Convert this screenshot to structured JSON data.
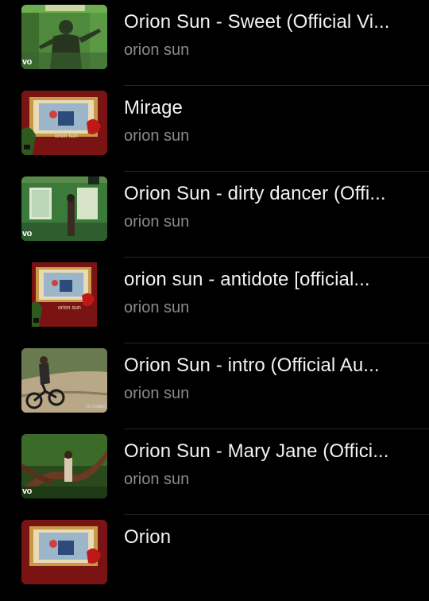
{
  "tracks": [
    {
      "title": "Orion Sun - Sweet (Official Vi...",
      "artist": "orion sun",
      "thumb": "green-room-performer",
      "badge": "vo"
    },
    {
      "title": "Mirage",
      "artist": "orion sun",
      "thumb": "album-art",
      "cover_text": "orion sun"
    },
    {
      "title": "Orion Sun - dirty dancer (Offi...",
      "artist": "orion sun",
      "thumb": "green-room-figure",
      "badge": "vo"
    },
    {
      "title": "orion sun - antidote [official...",
      "artist": "orion sun",
      "thumb": "album-art",
      "cover_text": "orion sun"
    },
    {
      "title": "Orion Sun - intro (Official Au...",
      "artist": "orion sun",
      "thumb": "bicycle-rider",
      "corner_label": "OCTOBER"
    },
    {
      "title": "Orion Sun - Mary Jane (Offici...",
      "artist": "orion sun",
      "thumb": "forest-scene",
      "badge": "vo"
    },
    {
      "title": "Orion",
      "artist": "",
      "thumb": "album-art"
    }
  ],
  "colors": {
    "background": "#000000",
    "title": "#f2f2f2",
    "subtitle": "#8a8a8e",
    "separator": "#262628"
  }
}
